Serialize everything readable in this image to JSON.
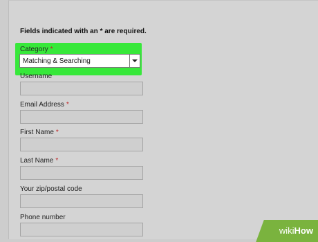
{
  "form": {
    "required_note": "Fields indicated with an * are required.",
    "required_mark": "*",
    "category": {
      "label": "Category",
      "value": "Matching & Searching"
    },
    "username": {
      "label": "Username",
      "value": ""
    },
    "email": {
      "label": "Email Address",
      "value": ""
    },
    "first_name": {
      "label": "First Name",
      "value": ""
    },
    "last_name": {
      "label": "Last Name",
      "value": ""
    },
    "zip": {
      "label": "Your zip/postal code",
      "value": ""
    },
    "phone": {
      "label": "Phone number",
      "value": ""
    }
  },
  "watermark": {
    "part1": "wiki",
    "part2": "How"
  },
  "colors": {
    "highlight": "#37e83a",
    "required": "#c0282a",
    "watermark_bg": "#7ab33e"
  }
}
